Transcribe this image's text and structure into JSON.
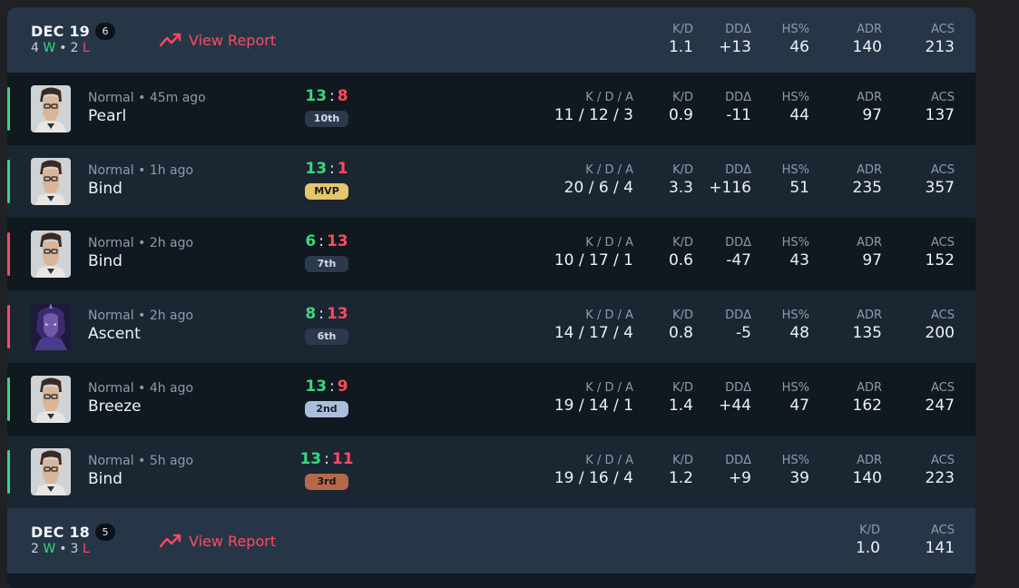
{
  "colors": {
    "win": "#3ad67f",
    "loss": "#ff4a5f",
    "accent": "#ff4a5f"
  },
  "days": [
    {
      "date": "DEC 19",
      "match_count": "6",
      "wins": "4",
      "win_letter": "W",
      "losses": "2",
      "loss_letter": "L",
      "separator": "•",
      "view_report": "View Report",
      "stats": {
        "kd": {
          "label": "K/D",
          "value": "1.1"
        },
        "dd": {
          "label": "DDΔ",
          "value": "+13"
        },
        "hs": {
          "label": "HS%",
          "value": "46"
        },
        "adr": {
          "label": "ADR",
          "value": "140"
        },
        "acs": {
          "label": "ACS",
          "value": "213"
        }
      }
    },
    {
      "date": "DEC 18",
      "match_count": "5",
      "wins": "2",
      "win_letter": "W",
      "losses": "3",
      "loss_letter": "L",
      "separator": "•",
      "view_report": "View Report",
      "stats": {
        "kd": {
          "label": "K/D",
          "value": "1.0"
        },
        "acs": {
          "label": "ACS",
          "value": "141"
        }
      }
    }
  ],
  "matches": [
    {
      "result": "win",
      "meta": "Normal • 45m ago",
      "map": "Pearl",
      "agent": "chamber",
      "score_a": "13",
      "score_b": "8",
      "sep": ":",
      "place": "10th",
      "place_style": "default",
      "kda_label": "K / D / A",
      "kda": "11 / 12 / 3",
      "kd_label": "K/D",
      "kd": "0.9",
      "dd_label": "DDΔ",
      "dd": "-11",
      "hs_label": "HS%",
      "hs": "44",
      "adr_label": "ADR",
      "adr": "97",
      "acs_label": "ACS",
      "acs": "137"
    },
    {
      "result": "win",
      "meta": "Normal • 1h ago",
      "map": "Bind",
      "agent": "chamber",
      "score_a": "13",
      "score_b": "1",
      "sep": ":",
      "place": "MVP",
      "place_style": "mvp",
      "kda_label": "K / D / A",
      "kda": "20 / 6 / 4",
      "kd_label": "K/D",
      "kd": "3.3",
      "dd_label": "DDΔ",
      "dd": "+116",
      "hs_label": "HS%",
      "hs": "51",
      "adr_label": "ADR",
      "adr": "235",
      "acs_label": "ACS",
      "acs": "357"
    },
    {
      "result": "loss",
      "meta": "Normal • 2h ago",
      "map": "Bind",
      "agent": "chamber",
      "score_a": "6",
      "score_b": "13",
      "sep": ":",
      "place": "7th",
      "place_style": "default",
      "kda_label": "K / D / A",
      "kda": "10 / 17 / 1",
      "kd_label": "K/D",
      "kd": "0.6",
      "dd_label": "DDΔ",
      "dd": "-47",
      "hs_label": "HS%",
      "hs": "43",
      "adr_label": "ADR",
      "adr": "97",
      "acs_label": "ACS",
      "acs": "152"
    },
    {
      "result": "loss",
      "meta": "Normal • 2h ago",
      "map": "Ascent",
      "agent": "reyna",
      "score_a": "8",
      "score_b": "13",
      "sep": ":",
      "place": "6th",
      "place_style": "default",
      "kda_label": "K / D / A",
      "kda": "14 / 17 / 4",
      "kd_label": "K/D",
      "kd": "0.8",
      "dd_label": "DDΔ",
      "dd": "-5",
      "hs_label": "HS%",
      "hs": "48",
      "adr_label": "ADR",
      "adr": "135",
      "acs_label": "ACS",
      "acs": "200"
    },
    {
      "result": "win",
      "meta": "Normal • 4h ago",
      "map": "Breeze",
      "agent": "chamber",
      "score_a": "13",
      "score_b": "9",
      "sep": ":",
      "place": "2nd",
      "place_style": "silver",
      "kda_label": "K / D / A",
      "kda": "19 / 14 / 1",
      "kd_label": "K/D",
      "kd": "1.4",
      "dd_label": "DDΔ",
      "dd": "+44",
      "hs_label": "HS%",
      "hs": "47",
      "adr_label": "ADR",
      "adr": "162",
      "acs_label": "ACS",
      "acs": "247"
    },
    {
      "result": "win",
      "meta": "Normal • 5h ago",
      "map": "Bind",
      "agent": "chamber",
      "score_a": "13",
      "score_b": "11",
      "sep": ":",
      "place": "3rd",
      "place_style": "bronze",
      "kda_label": "K / D / A",
      "kda": "19 / 16 / 4",
      "kd_label": "K/D",
      "kd": "1.2",
      "dd_label": "DDΔ",
      "dd": "+9",
      "hs_label": "HS%",
      "hs": "39",
      "adr_label": "ADR",
      "adr": "140",
      "acs_label": "ACS",
      "acs": "223"
    }
  ]
}
